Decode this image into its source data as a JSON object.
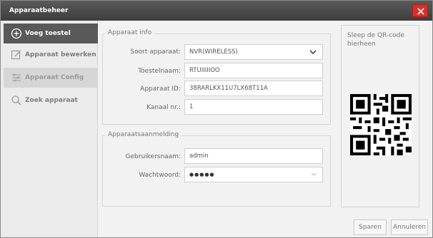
{
  "window": {
    "title": "Apparaatbeheer"
  },
  "sidebar": {
    "items": [
      {
        "label": "Voeg toestel",
        "icon": "plus-circle-icon",
        "state": "active"
      },
      {
        "label": "Apparaat bewerken",
        "icon": "edit-icon",
        "state": "plain"
      },
      {
        "label": "Apparaat Config",
        "icon": "config-icon",
        "state": "dim"
      },
      {
        "label": "Zoek apparaat",
        "icon": "search-icon",
        "state": "plain"
      }
    ]
  },
  "device_info": {
    "title": "Apparaat info",
    "type_label": "Soort apparaat:",
    "type_value": "NVR(WIRELESS)",
    "name_label": "Toestelnaam:",
    "name_value": "RTUIIIIIOO",
    "id_label": "Apparaat ID:",
    "id_value": "38RARLKX11U7LX68T11A",
    "channel_label": "Kanaal nr.:",
    "channel_value": "1"
  },
  "login": {
    "title": "Apparaatsaanmelding",
    "user_label": "Gebruikersnaam:",
    "user_value": "admin",
    "password_label": "Wachtwoord:",
    "password_value": "●●●●●"
  },
  "qr": {
    "text": "Sleep de QR-code hierheen"
  },
  "buttons": {
    "save": "Sparen",
    "cancel": "Annuleren"
  },
  "colors": {
    "titlebar": "#4a4a4a",
    "close": "#d9302a",
    "active_nav": "#595959"
  }
}
